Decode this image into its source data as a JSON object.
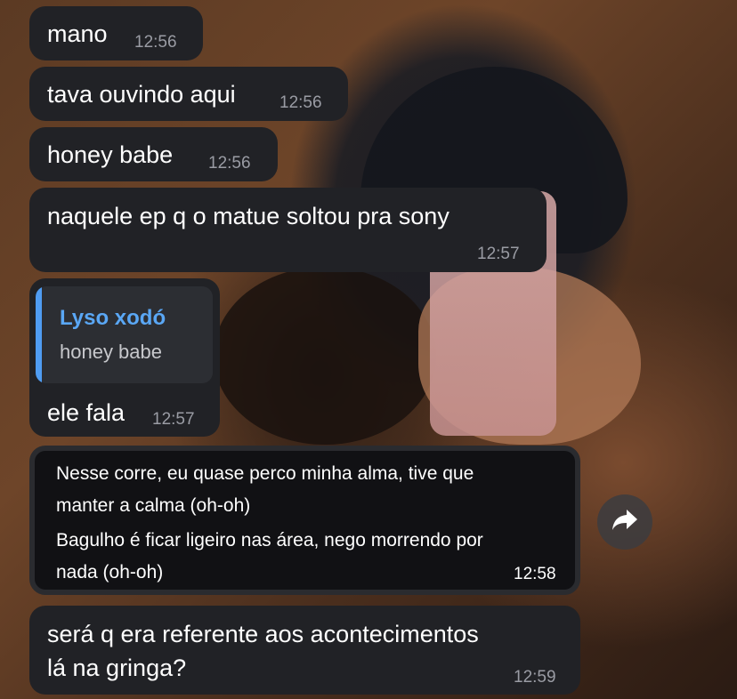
{
  "messages": [
    {
      "text": "mano",
      "time": "12:56"
    },
    {
      "text": "tava ouvindo aqui",
      "time": "12:56"
    },
    {
      "text": "honey babe",
      "time": "12:56"
    },
    {
      "text": "naquele ep q o matue soltou pra sony",
      "time": "12:57"
    },
    {
      "reply": {
        "name": "Lyso xodó",
        "text": "honey babe"
      },
      "text": "ele fala",
      "time": "12:57"
    },
    {
      "lines": [
        "Nesse corre, eu quase perco minha alma, tive que",
        "manter a calma (oh-oh)",
        "Bagulho é ficar ligeiro nas área, nego morrendo por",
        "nada (oh-oh)"
      ],
      "time": "12:58"
    },
    {
      "lines": [
        "será q era referente aos acontecimentos",
        "lá na gringa?"
      ],
      "time": "12:59"
    }
  ],
  "icons": {
    "forward": "forward-arrow-icon"
  },
  "colors": {
    "bubble": "#212226",
    "reply_accent": "#4f9cf2",
    "time": "#9a9ca4"
  }
}
